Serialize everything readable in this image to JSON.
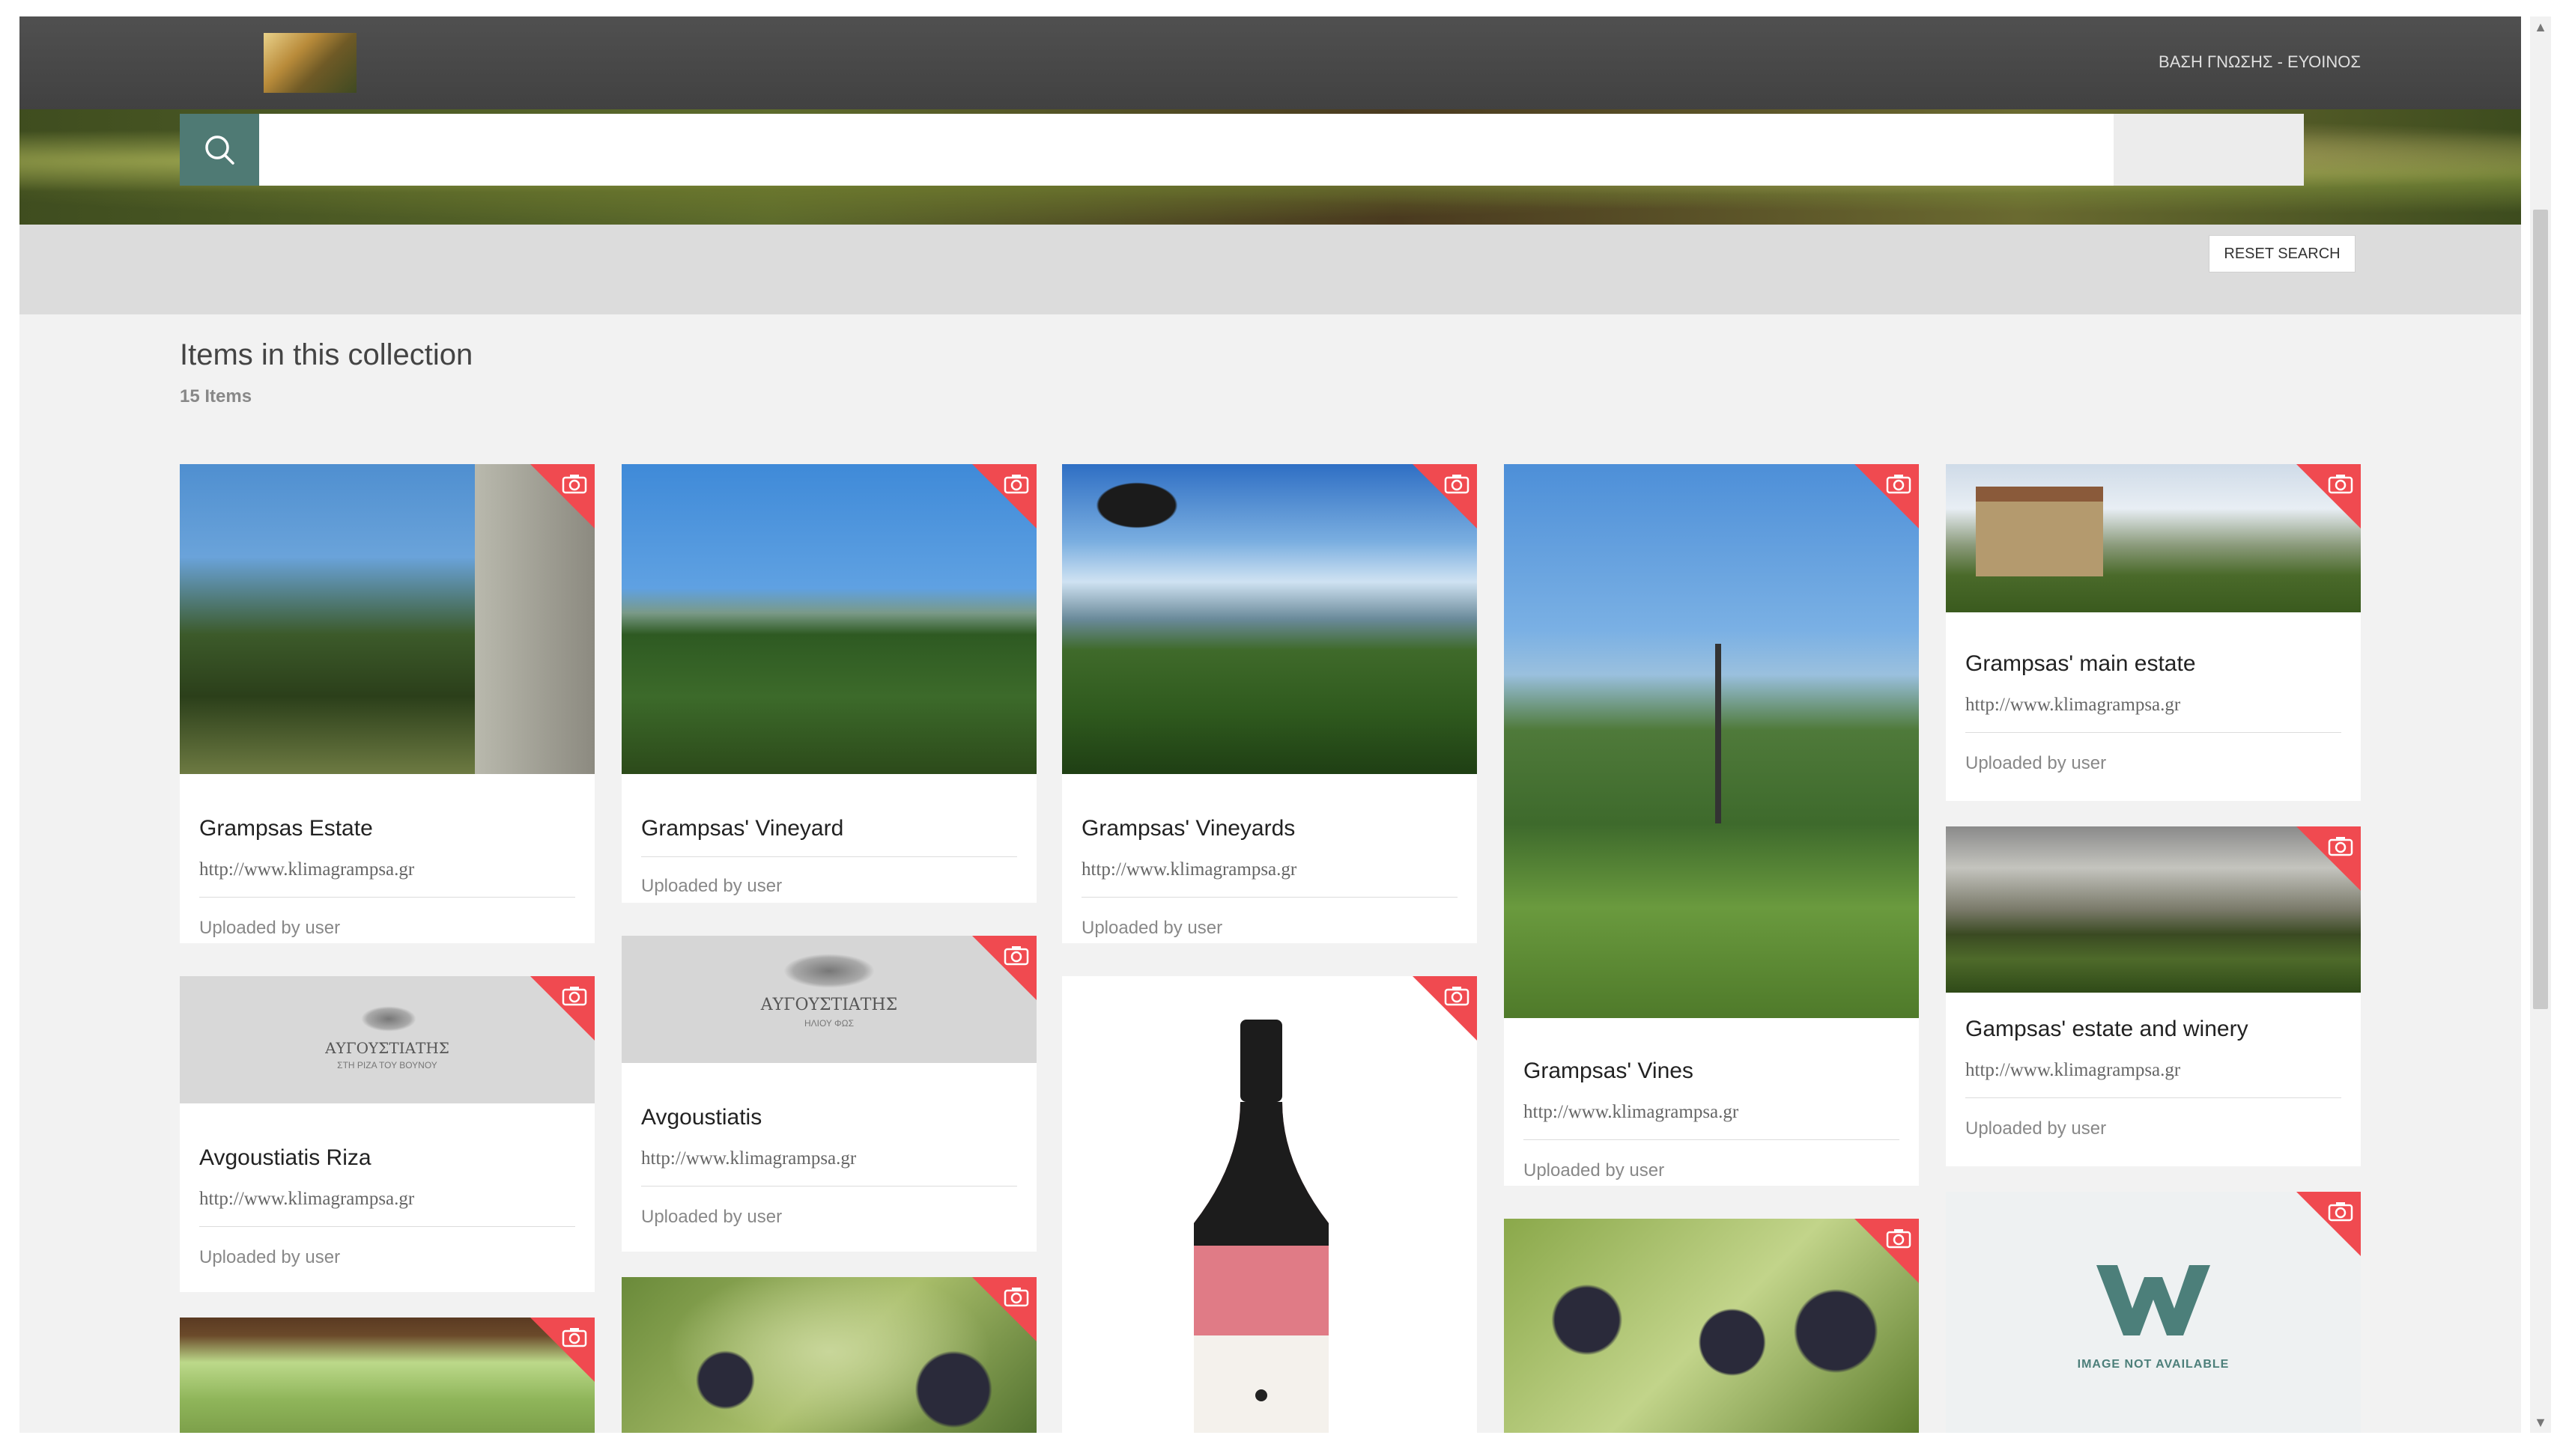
{
  "header": {
    "nav_label": "ΒΑΣΗ ΓΝΩΣΗΣ - ΕΥΟΙΝΟΣ"
  },
  "search": {
    "placeholder": "",
    "reset_label": "RESET SEARCH"
  },
  "collection": {
    "title": "Items in this collection",
    "count": "15 Items"
  },
  "cards": [
    {
      "title": "Grampsas Estate",
      "url": "http://www.klimagrampsa.gr",
      "meta": "Uploaded by user"
    },
    {
      "title": "Avgoustiatis Riza",
      "url": "http://www.klimagrampsa.gr",
      "meta": "Uploaded by user",
      "thumb_text": "ΑΥΓΟΥΣΤΙΑΤΗΣ",
      "thumb_subtext": "ΣΤΗ ΡΙΖΑ ΤΟΥ ΒΟΥΝΟΥ"
    },
    {
      "title": "Grampsas' Vineyard",
      "meta": "Uploaded by user"
    },
    {
      "title": "Avgoustiatis",
      "url": "http://www.klimagrampsa.gr",
      "meta": "Uploaded by user",
      "thumb_text": "ΑΥΓΟΥΣΤΙΑΤΗΣ",
      "thumb_subtext": "ΗΛΙΟΥ ΦΩΣ"
    },
    {
      "title": "Grampsas' Vineyards",
      "url": "http://www.klimagrampsa.gr",
      "meta": "Uploaded by user"
    },
    {
      "title": "Grampsas' Vines",
      "url": "http://www.klimagrampsa.gr",
      "meta": "Uploaded by user"
    },
    {
      "title": "Grampsas' main estate",
      "url": "http://www.klimagrampsa.gr",
      "meta": "Uploaded by user"
    },
    {
      "title": "Gampsas' estate and winery",
      "url": "http://www.klimagrampsa.gr",
      "meta": "Uploaded by user"
    },
    {
      "thumb_text": "IMAGE NOT AVAILABLE"
    }
  ],
  "colors": {
    "topbar": "#464646",
    "search_button": "#4f7a74",
    "corner_badge": "#f04a50",
    "page_background": "#f2f2f2"
  },
  "icons": [
    "search-icon",
    "camera-icon"
  ]
}
